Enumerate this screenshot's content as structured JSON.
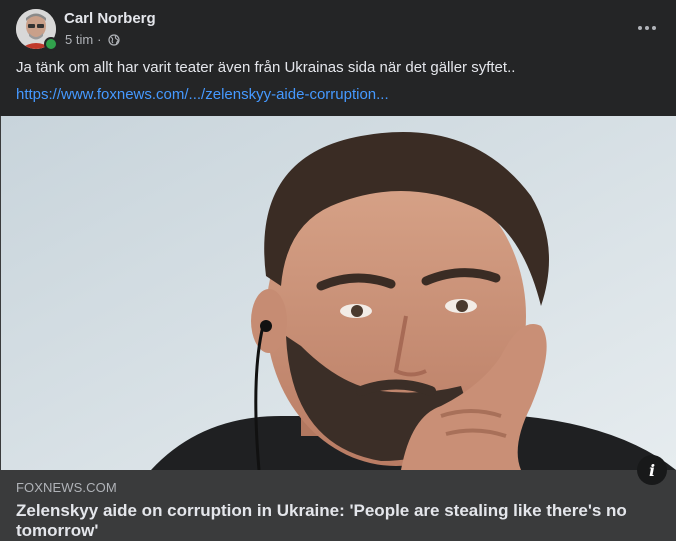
{
  "post": {
    "author": "Carl Norberg",
    "time": "5 tim",
    "separator": "·",
    "audience_icon": "globe-icon",
    "online": true,
    "more_icon": "more-options-icon",
    "text": "Ja tänk om allt har varit teater även från Ukrainas sida när det gäller syftet..",
    "link_text": "https://www.foxnews.com/.../zelenskyy-aide-corruption..."
  },
  "link_preview": {
    "domain": "FOXNEWS.COM",
    "title": "Zelenskyy aide on corruption in Ukraine: 'People are stealing like there's no tomorrow'",
    "info_icon": "info-icon",
    "image_desc_icon": "news-photo"
  },
  "colors": {
    "background": "#242526",
    "preview_footer": "#3a3b3c",
    "text_primary": "#e4e6eb",
    "text_secondary": "#b0b3b8",
    "link": "#4599ff",
    "online": "#31a24c"
  }
}
